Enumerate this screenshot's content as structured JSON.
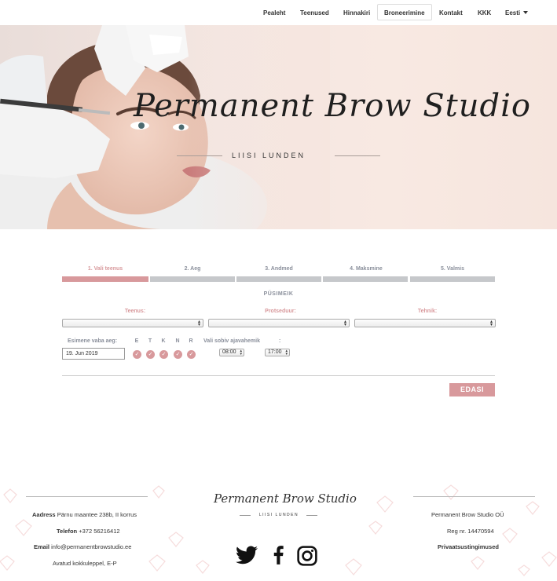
{
  "nav": {
    "items": [
      {
        "label": "Pealeht"
      },
      {
        "label": "Teenused"
      },
      {
        "label": "Hinnakiri"
      },
      {
        "label": "Broneerimine"
      },
      {
        "label": "Kontakt"
      },
      {
        "label": "KKK"
      }
    ],
    "language": "Eesti",
    "active_index": 3
  },
  "hero": {
    "title": "Permanent Brow Studio",
    "subtitle": "LIISI LUNDEN"
  },
  "booking": {
    "steps": [
      {
        "label": "1. Vali teenus"
      },
      {
        "label": "2. Aeg"
      },
      {
        "label": "3. Andmed"
      },
      {
        "label": "4. Maksmine"
      },
      {
        "label": "5. Valmis"
      }
    ],
    "current_step": 1,
    "section_title": "PÜSIMEIK",
    "fields": {
      "teenus_label": "Teenus:",
      "protseduur_label": "Protseduur:",
      "tehnik_label": "Tehnik:"
    },
    "first_free_label": "Esimene vaba aeg:",
    "first_free_value": "19. Jun 2019",
    "days": [
      "E",
      "T",
      "K",
      "N",
      "R"
    ],
    "time_range_label": "Vali sobiv ajavahemik",
    "time_separator": ":",
    "time_from": "08:00",
    "time_to": "17:00",
    "next_button": "EDASI"
  },
  "footer": {
    "address_label": "Aadress",
    "address_value": "Pärnu maantee 238b, II korrus",
    "phone_label": "Telefon",
    "phone_value": "+372 56216412",
    "email_label": "Email",
    "email_value": "info@permanentbrowstudio.ee",
    "hours": "Avatud kokkuleppel, E-P",
    "logo_title": "Permanent Brow Studio",
    "logo_subtitle": "LIISI LUNDEN",
    "company": "Permanent Brow Studio OÜ",
    "reg": "Reg nr. 14470594",
    "privacy": "Privaatsustingimused"
  },
  "colors": {
    "accent": "#d8999c",
    "muted": "#8a8f9b",
    "bar_inactive": "#c6c8cb"
  }
}
